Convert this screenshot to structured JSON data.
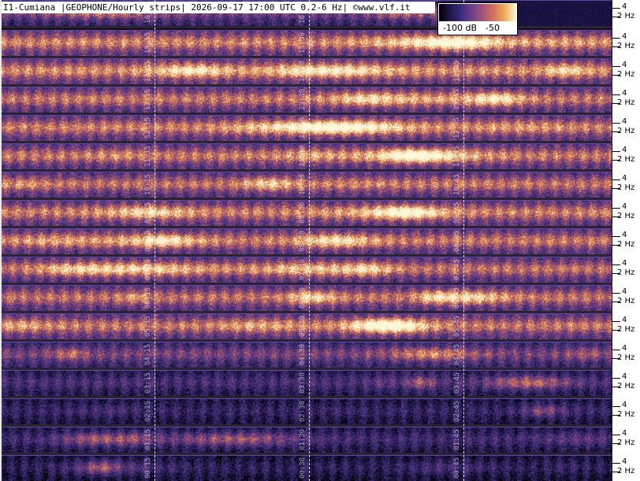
{
  "header": {
    "title": "I1-Cumiana |GEOPHONE/Hourly strips| 2026-09-17 17:00 UTC 0.2-6 Hz| ©www.vlf.it"
  },
  "colorbar": {
    "min_label": "-100 dB",
    "max_label": "-50",
    "colors": [
      "#000000",
      "#1b1440",
      "#3a2a7a",
      "#6a3f8a",
      "#a4527a",
      "#d8775a",
      "#f3b060",
      "#fff6d8"
    ]
  },
  "chart_data": {
    "type": "heatmap",
    "title": "I1-Cumiana |GEOPHONE/Hourly strips| 2026-09-17 17:00 UTC 0.2-6 Hz| ©www.vlf.it",
    "y_tick_labels": [
      "4",
      "2 Hz"
    ],
    "colorbar_range_db": [
      -100,
      -50
    ],
    "strips": [
      {
        "hour": 16,
        "tick_labels": [
          "16:15",
          "16:30",
          ""
        ],
        "intensity": 0.5,
        "partial": true
      },
      {
        "hour": 15,
        "tick_labels": [
          "15:15",
          "15:30",
          "15:45"
        ],
        "intensity": 0.78
      },
      {
        "hour": 14,
        "tick_labels": [
          "14:15",
          "14:30",
          "14:45"
        ],
        "intensity": 0.8
      },
      {
        "hour": 13,
        "tick_labels": [
          "13:15",
          "13:30",
          "13:45"
        ],
        "intensity": 0.74
      },
      {
        "hour": 12,
        "tick_labels": [
          "12:15",
          "12:30",
          "12:45"
        ],
        "intensity": 0.76
      },
      {
        "hour": 11,
        "tick_labels": [
          "11:15",
          "11:30",
          "11:45"
        ],
        "intensity": 0.74
      },
      {
        "hour": 10,
        "tick_labels": [
          "10:15",
          "10:30",
          "10:45"
        ],
        "intensity": 0.72
      },
      {
        "hour": 9,
        "tick_labels": [
          "09:15",
          "09:30",
          "09:45"
        ],
        "intensity": 0.76
      },
      {
        "hour": 8,
        "tick_labels": [
          "08:15",
          "08:30",
          "08:45"
        ],
        "intensity": 0.74
      },
      {
        "hour": 7,
        "tick_labels": [
          "07:15",
          "07:30",
          "07:45"
        ],
        "intensity": 0.72
      },
      {
        "hour": 6,
        "tick_labels": [
          "06:15",
          "06:30",
          "06:45"
        ],
        "intensity": 0.72
      },
      {
        "hour": 5,
        "tick_labels": [
          "05:15",
          "05:30",
          "05:45"
        ],
        "intensity": 0.74
      },
      {
        "hour": 4,
        "tick_labels": [
          "04:15",
          "04:30",
          "04:45"
        ],
        "intensity": 0.52
      },
      {
        "hour": 3,
        "tick_labels": [
          "03:15",
          "03:30",
          "03:45"
        ],
        "intensity": 0.36
      },
      {
        "hour": 2,
        "tick_labels": [
          "02:15",
          "02:30",
          "02:45"
        ],
        "intensity": 0.28
      },
      {
        "hour": 1,
        "tick_labels": [
          "01:15",
          "01:30",
          "01:45"
        ],
        "intensity": 0.32
      },
      {
        "hour": 0,
        "tick_labels": [
          "00:15",
          "00:30",
          "00:45"
        ],
        "intensity": 0.24
      }
    ]
  }
}
